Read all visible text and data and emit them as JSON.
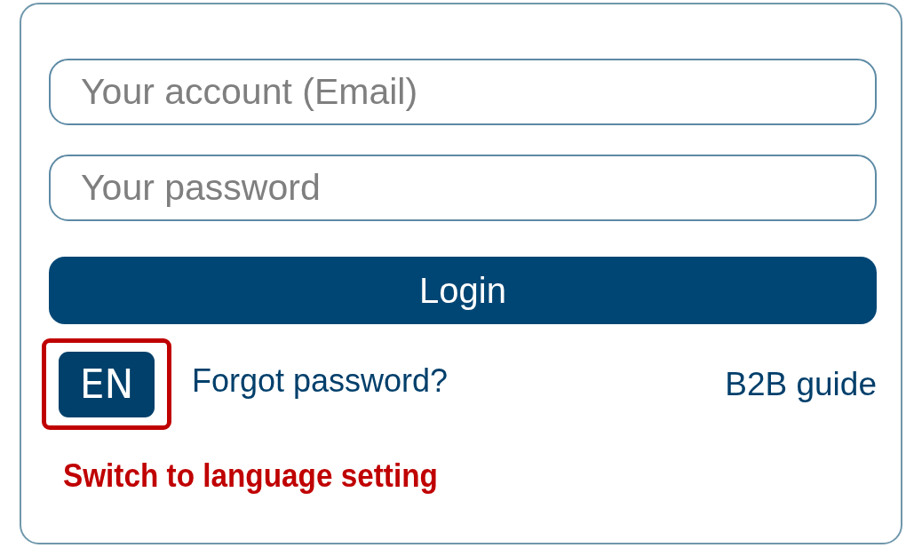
{
  "login_form": {
    "email": {
      "placeholder": "Your account (Email)"
    },
    "password": {
      "placeholder": "Your password"
    },
    "login_button": "Login",
    "language_button": {
      "label": "EN",
      "highlighted": true
    },
    "forgot_password": "Forgot password?",
    "guide_link": "B2B guide",
    "annotation": "Switch to language setting"
  }
}
